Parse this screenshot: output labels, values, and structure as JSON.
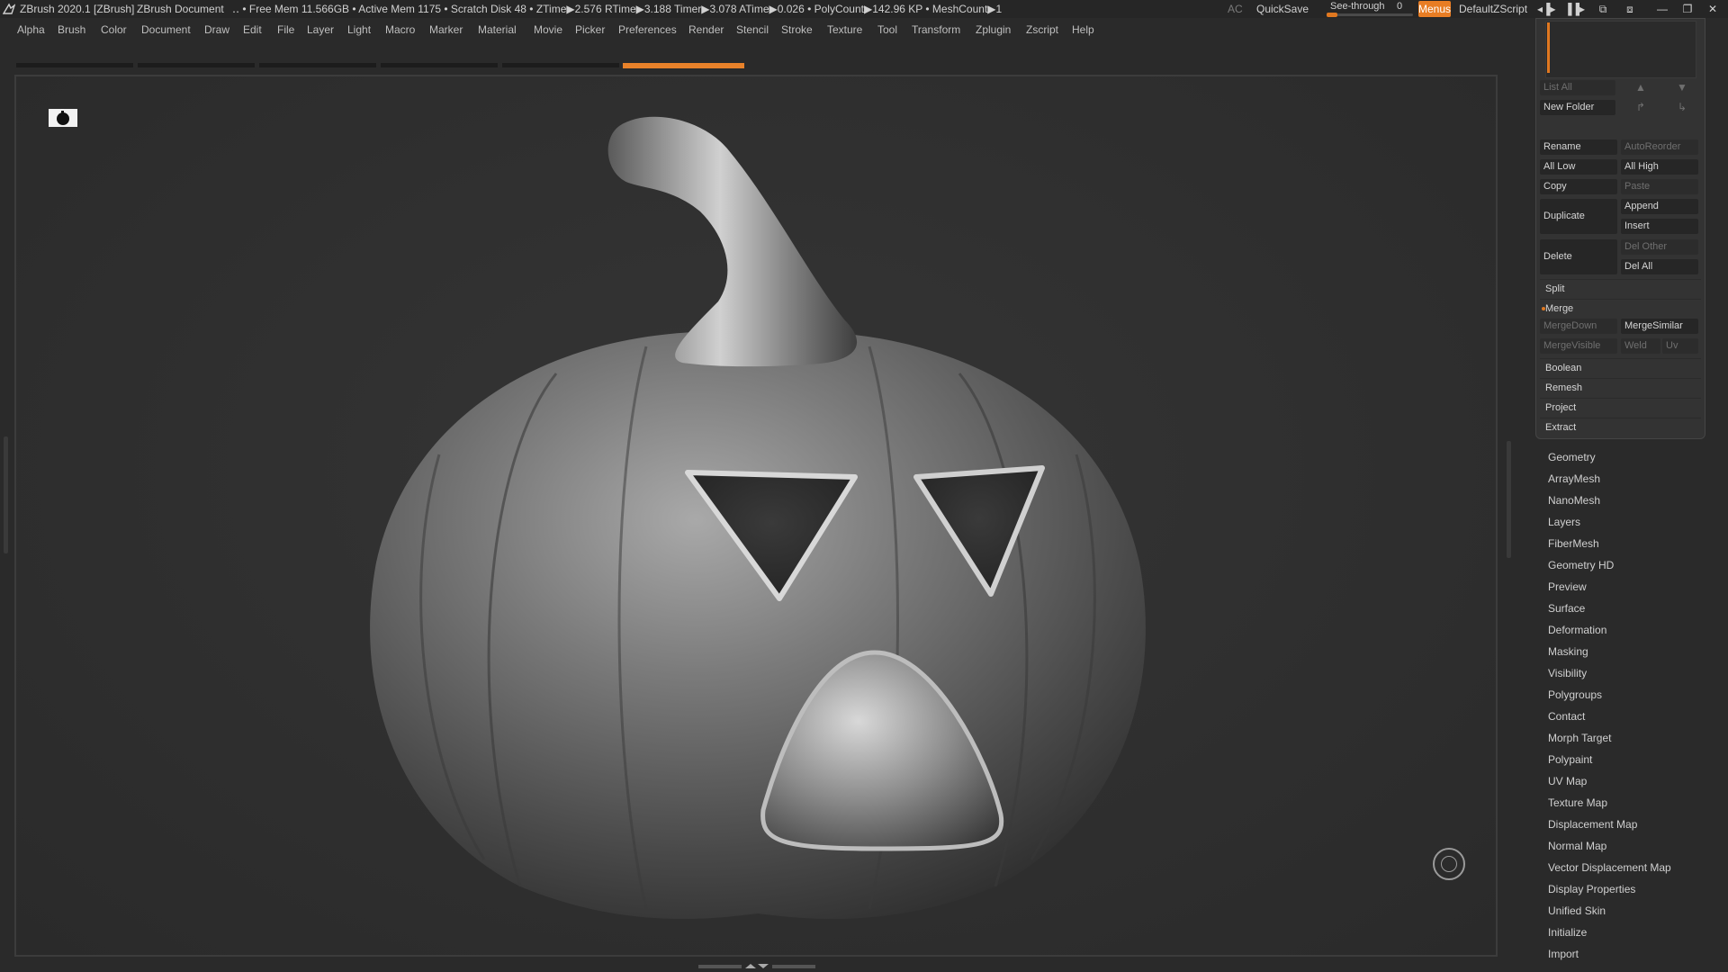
{
  "titlebar": {
    "app_title": "ZBrush 2020.1 [ZBrush]",
    "document": "ZBrush Document",
    "stats": "‥ • Free Mem 11.566GB • Active Mem 1175 • Scratch Disk 48 •  ZTime▶2.576 RTime▶3.188 Timer▶3.078 ATime▶0.026 • PolyCount▶142.96 KP  • MeshCount▶1",
    "ac": "AC",
    "quicksave": "QuickSave",
    "see_through_label": "See-through",
    "see_through_value": "0",
    "menus": "Menus",
    "script": "DefaultZScript"
  },
  "menubar": [
    "Alpha",
    "Brush",
    "Color",
    "Document",
    "Draw",
    "Edit",
    "File",
    "Layer",
    "Light",
    "Macro",
    "Marker",
    "Material",
    "Movie",
    "Picker",
    "Preferences",
    "Render",
    "Stencil",
    "Stroke",
    "Texture",
    "Tool",
    "Transform",
    "Zplugin",
    "Zscript",
    "Help"
  ],
  "subtool": {
    "list_all": "List All",
    "new_folder": "New Folder",
    "rename": "Rename",
    "auto_reorder": "AutoReorder",
    "all_low": "All Low",
    "all_high": "All High",
    "copy": "Copy",
    "paste": "Paste",
    "duplicate": "Duplicate",
    "append": "Append",
    "insert": "Insert",
    "delete": "Delete",
    "del_other": "Del Other",
    "del_all": "Del All",
    "split": "Split",
    "merge": "Merge",
    "merge_down": "MergeDown",
    "merge_similar": "MergeSimilar",
    "merge_visible": "MergeVisible",
    "weld": "Weld",
    "uv": "Uv",
    "boolean": "Boolean",
    "remesh": "Remesh",
    "project": "Project",
    "extract": "Extract"
  },
  "tool_subpalettes": [
    "Geometry",
    "ArrayMesh",
    "NanoMesh",
    "Layers",
    "FiberMesh",
    "Geometry HD",
    "Preview",
    "Surface",
    "Deformation",
    "Masking",
    "Visibility",
    "Polygroups",
    "Contact",
    "Morph Target",
    "Polypaint",
    "UV Map",
    "Texture Map",
    "Displacement Map",
    "Normal Map",
    "Vector Displacement Map",
    "Display Properties",
    "Unified Skin",
    "Initialize",
    "Import"
  ],
  "colors": {
    "accent": "#e8822a",
    "canvas_bg": "#2f2f2f",
    "panel_bg": "#333333"
  },
  "icons": [
    "zbrush-logo-icon",
    "camera-thumbnail-icon",
    "navigation-gizmo-icon",
    "minimize-icon",
    "restore-icon",
    "close-icon"
  ]
}
